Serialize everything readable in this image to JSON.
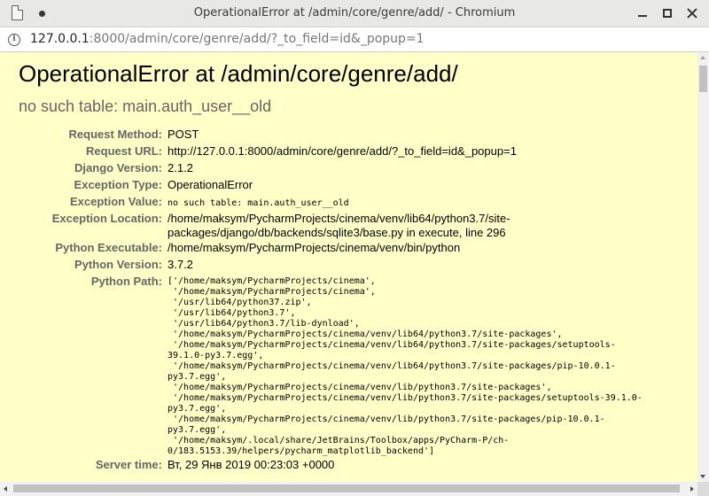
{
  "window": {
    "title": "OperationalError at /admin/core/genre/add/ - Chromium"
  },
  "address_bar": {
    "url_host": "127.0.0.1",
    "url_rest": ":8000/admin/core/genre/add/?_to_field=id&_popup=1"
  },
  "error": {
    "heading": "OperationalError at /admin/core/genre/add/",
    "message": "no such table: main.auth_user__old"
  },
  "details": {
    "request_method": {
      "label": "Request Method:",
      "value": "POST"
    },
    "request_url": {
      "label": "Request URL:",
      "value": "http://127.0.0.1:8000/admin/core/genre/add/?_to_field=id&_popup=1"
    },
    "django_version": {
      "label": "Django Version:",
      "value": "2.1.2"
    },
    "exception_type": {
      "label": "Exception Type:",
      "value": "OperationalError"
    },
    "exception_value": {
      "label": "Exception Value:",
      "value": "no such table: main.auth_user__old"
    },
    "exception_location": {
      "label": "Exception Location:",
      "value_line1": "/home/maksym/PycharmProjects/cinema/venv/lib64/python3.7/site-",
      "value_line2": "packages/django/db/backends/sqlite3/base.py in execute, line 296"
    },
    "python_executable": {
      "label": "Python Executable:",
      "value": "/home/maksym/PycharmProjects/cinema/venv/bin/python"
    },
    "python_version": {
      "label": "Python Version:",
      "value": "3.7.2"
    },
    "python_path": {
      "label": "Python Path:",
      "value": "['/home/maksym/PycharmProjects/cinema',\n '/home/maksym/PycharmProjects/cinema',\n '/usr/lib64/python37.zip',\n '/usr/lib64/python3.7',\n '/usr/lib64/python3.7/lib-dynload',\n '/home/maksym/PycharmProjects/cinema/venv/lib64/python3.7/site-packages',\n '/home/maksym/PycharmProjects/cinema/venv/lib64/python3.7/site-packages/setuptools-\n39.1.0-py3.7.egg',\n '/home/maksym/PycharmProjects/cinema/venv/lib64/python3.7/site-packages/pip-10.0.1-\npy3.7.egg',\n '/home/maksym/PycharmProjects/cinema/venv/lib/python3.7/site-packages',\n '/home/maksym/PycharmProjects/cinema/venv/lib/python3.7/site-packages/setuptools-39.1.0-\npy3.7.egg',\n '/home/maksym/PycharmProjects/cinema/venv/lib/python3.7/site-packages/pip-10.0.1-\npy3.7.egg',\n '/home/maksym/.local/share/JetBrains/Toolbox/apps/PyCharm-P/ch-\n0/183.5153.39/helpers/pycharm_matplotlib_backend']"
    },
    "server_time": {
      "label": "Server time:",
      "value": "Вт, 29 Янв 2019 00:23:03 +0000"
    }
  },
  "colors": {
    "page_background": "#ffffc8",
    "label_color": "#666666",
    "subtitle_color": "#666666"
  },
  "icons": {
    "tab_icon": "document-icon",
    "site_info": "info-icon"
  }
}
